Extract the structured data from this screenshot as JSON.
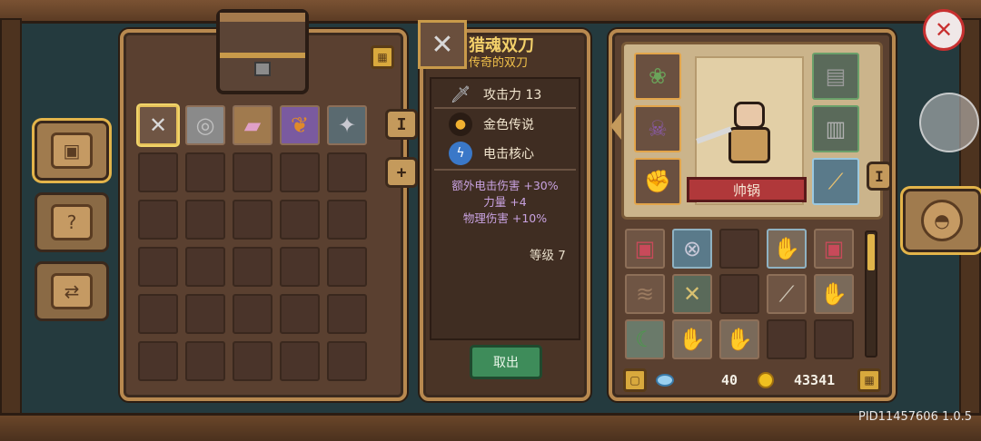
{
  "item": {
    "name": "猎魂双刀",
    "subtitle": "传奇的双刀",
    "attack_label": "攻击力 13",
    "rarity_label": "金色传说",
    "core_label": "电击核心",
    "bonuses": [
      "额外电击伤害 +30%",
      "力量 +4",
      "物理伤害 +10%"
    ],
    "level_label": "等级 7",
    "take_out_label": "取出"
  },
  "chest": {
    "tab_label": "I",
    "add_tab_label": "+",
    "items": [
      "crossed-blades-icon",
      "shield-icon",
      "scroll-icon",
      "pumpkin-icon",
      "battle-axe-icon"
    ]
  },
  "hero": {
    "name": "帅锅",
    "tab_label": "I"
  },
  "currency": {
    "gems": "40",
    "coins": "43341"
  },
  "footer": {
    "pid": "PID11457606 1.0.5"
  },
  "colors": {
    "panel": "#5a4030",
    "frame": "#b8894f",
    "bonus_text": "#c8a2e0",
    "take_button": "#3e8c5a",
    "nameplate": "#b0383a",
    "accent_gold": "#e0b44a"
  }
}
